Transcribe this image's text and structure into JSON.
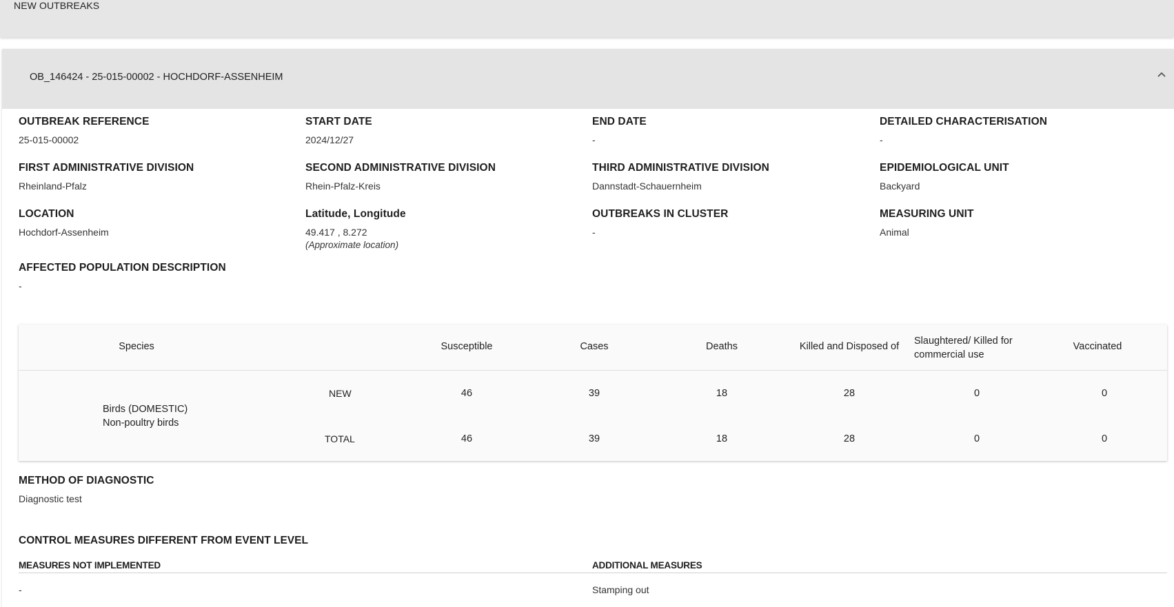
{
  "top_bar": {
    "title": "NEW OUTBREAKS"
  },
  "panel": {
    "title": "OB_146424 - 25-015-00002 - HOCHDORF-ASSENHEIM",
    "fields": {
      "outbreak_reference": {
        "label": "OUTBREAK REFERENCE",
        "value": "25-015-00002"
      },
      "start_date": {
        "label": "START DATE",
        "value": "2024/12/27"
      },
      "end_date": {
        "label": "END DATE",
        "value": "-"
      },
      "detailed_characterisation": {
        "label": "DETAILED CHARACTERISATION",
        "value": "-"
      },
      "first_admin": {
        "label": "FIRST ADMINISTRATIVE DIVISION",
        "value": "Rheinland-Pfalz"
      },
      "second_admin": {
        "label": "SECOND ADMINISTRATIVE DIVISION",
        "value": "Rhein-Pfalz-Kreis"
      },
      "third_admin": {
        "label": "THIRD ADMINISTRATIVE DIVISION",
        "value": "Dannstadt-Schauernheim"
      },
      "epi_unit": {
        "label": "EPIDEMIOLOGICAL UNIT",
        "value": "Backyard"
      },
      "location": {
        "label": "LOCATION",
        "value": "Hochdorf-Assenheim"
      },
      "lat_long": {
        "label": "Latitude, Longitude",
        "value": "49.417 , 8.272",
        "note": "(Approximate location)"
      },
      "outbreaks_in_cluster": {
        "label": "OUTBREAKS IN CLUSTER",
        "value": "-"
      },
      "measuring_unit": {
        "label": "MEASURING UNIT",
        "value": "Animal"
      },
      "affected_population": {
        "label": "AFFECTED POPULATION DESCRIPTION",
        "value": "-"
      }
    },
    "table": {
      "headers": {
        "species": "Species",
        "susceptible": "Susceptible",
        "cases": "Cases",
        "deaths": "Deaths",
        "killed": "Killed and Disposed of",
        "slaughtered_line1": "Slaughtered/ Killed for",
        "slaughtered_line2": "commercial use",
        "vaccinated": "Vaccinated"
      },
      "species_line1": "Birds (DOMESTIC)",
      "species_line2": "Non-poultry birds",
      "rows": [
        {
          "label": "NEW",
          "susceptible": "46",
          "cases": "39",
          "deaths": "18",
          "killed": "28",
          "slaughtered": "0",
          "vaccinated": "0"
        },
        {
          "label": "TOTAL",
          "susceptible": "46",
          "cases": "39",
          "deaths": "18",
          "killed": "28",
          "slaughtered": "0",
          "vaccinated": "0"
        }
      ]
    },
    "method_of_diagnostic": {
      "label": "METHOD OF DIAGNOSTIC",
      "value": "Diagnostic test"
    },
    "control_measures": {
      "title": "CONTROL MEASURES DIFFERENT FROM EVENT LEVEL",
      "not_implemented_label": "MEASURES NOT IMPLEMENTED",
      "not_implemented_value": "-",
      "additional_label": "ADDITIONAL MEASURES",
      "additional_value": "Stamping out"
    }
  },
  "icons": {
    "collapse": "chevron-up-icon"
  },
  "colors": {
    "header_bg": "#e6e6e6",
    "panel_header_bg": "#e4e4e4",
    "table_bg": "#fafafa"
  }
}
